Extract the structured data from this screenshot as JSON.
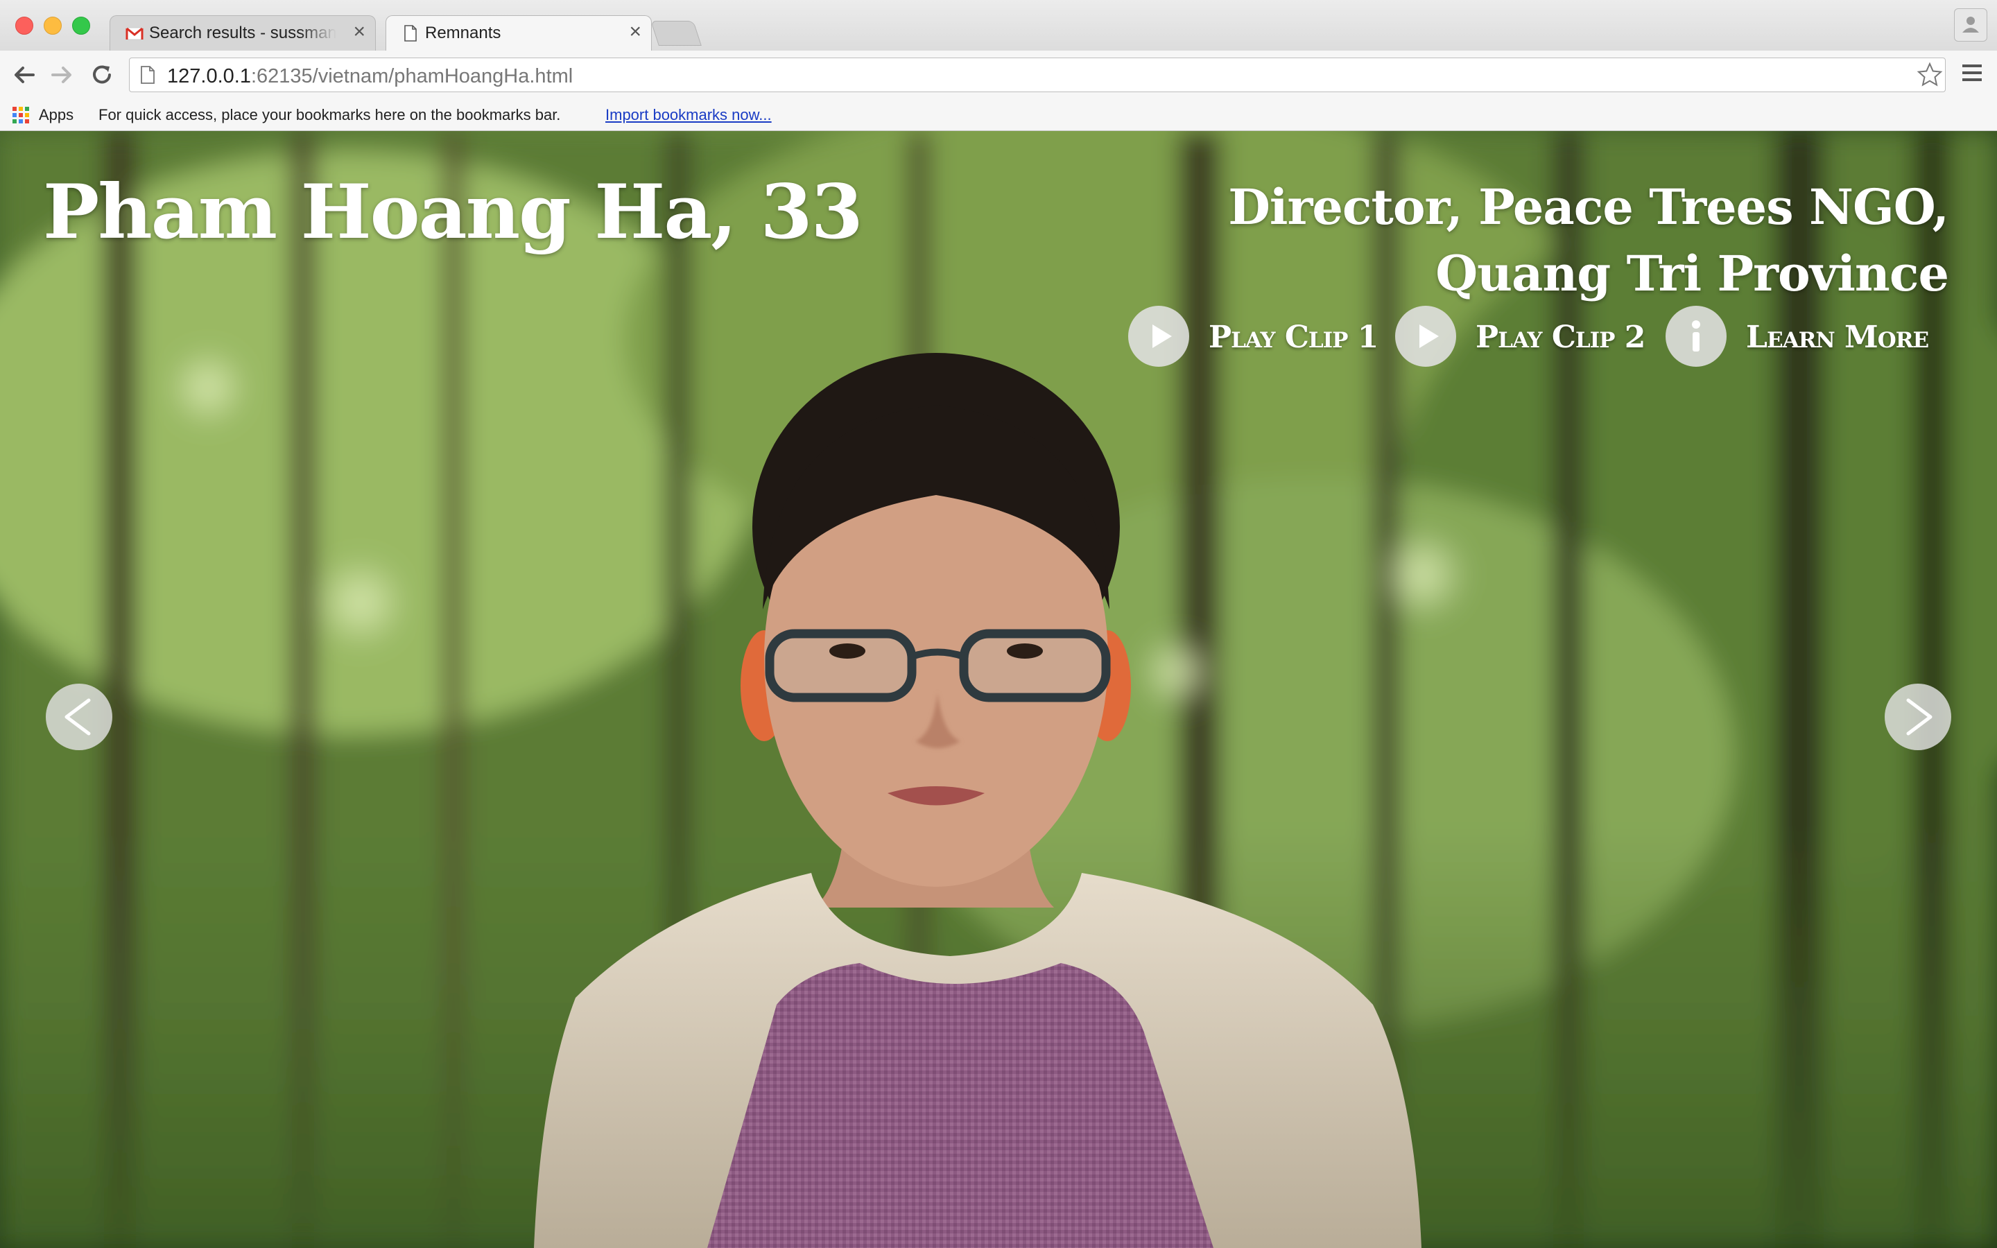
{
  "browser": {
    "tabs": [
      {
        "title": "Search results - sussmanja",
        "icon": "gmail-icon",
        "active": false
      },
      {
        "title": "Remnants",
        "icon": "page-icon",
        "active": true
      }
    ],
    "url_host": "127.0.0.1",
    "url_port_path": ":62135/vietnam/phamHoangHa.html",
    "bookmarks_bar": {
      "apps_label": "Apps",
      "hint": "For quick access, place your bookmarks here on the bookmarks bar.",
      "import_link": "Import bookmarks now..."
    }
  },
  "page": {
    "name": "Pham Hoang Ha, 33",
    "role": "Director, Peace Trees NGO, Quang Tri Province",
    "actions": [
      {
        "label": "Play Clip 1",
        "icon": "play-icon"
      },
      {
        "label": "Play Clip 2",
        "icon": "play-icon"
      },
      {
        "label": "Learn More",
        "icon": "info-icon"
      }
    ],
    "prev_icon": "chevron-left-icon",
    "next_icon": "chevron-right-icon"
  },
  "colors": {
    "accent_link": "#1a3cc4",
    "button_bg": "#e1e1e1"
  }
}
